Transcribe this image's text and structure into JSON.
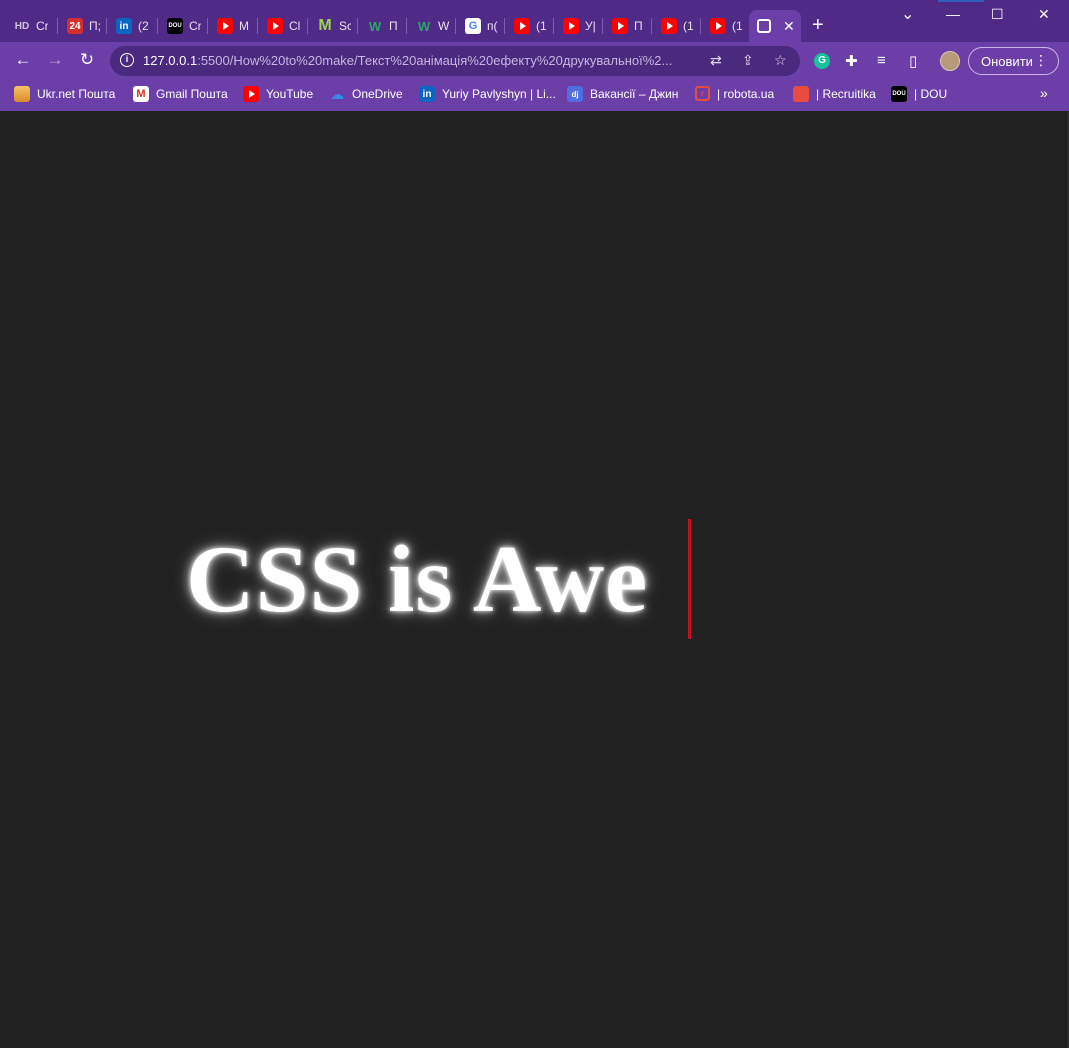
{
  "browser": {
    "tabs": [
      {
        "favicon": "hd-icon",
        "title": "Cr"
      },
      {
        "favicon": "news24-icon",
        "title": "П;"
      },
      {
        "favicon": "linkedin-icon",
        "title": "(2"
      },
      {
        "favicon": "dou-icon",
        "title": "Cr"
      },
      {
        "favicon": "youtube-icon",
        "title": "M"
      },
      {
        "favicon": "youtube-icon",
        "title": "Cl"
      },
      {
        "favicon": "m-icon",
        "title": "Sc"
      },
      {
        "favicon": "w-icon",
        "title": "П"
      },
      {
        "favicon": "w-icon",
        "title": "W"
      },
      {
        "favicon": "google-icon",
        "title": "п("
      },
      {
        "favicon": "youtube-icon",
        "title": "(1"
      },
      {
        "favicon": "youtube-icon",
        "title": "У|"
      },
      {
        "favicon": "youtube-icon",
        "title": "П"
      },
      {
        "favicon": "youtube-icon",
        "title": "(1"
      },
      {
        "favicon": "youtube-icon",
        "title": "(1"
      }
    ],
    "active_tab": {
      "favicon": "globe-icon",
      "close": "✕"
    },
    "new_tab": "+",
    "window_controls": {
      "dropdown": "⌄",
      "minimize": "—",
      "maximize": "☐",
      "close": "✕"
    },
    "url": {
      "host": "127.0.0.1",
      "rest": ":5500/How%20to%20make/Текст%20анімація%20ефекту%20друкувальної%2..."
    },
    "update_button": "Оновити",
    "bookmarks": [
      {
        "favicon": "ukrnet-icon",
        "label": "Ukr.net Пошта"
      },
      {
        "favicon": "gmail-icon",
        "label": "Gmail Пошта"
      },
      {
        "favicon": "youtube-icon",
        "label": "YouTube"
      },
      {
        "favicon": "onedrive-icon",
        "label": "OneDrive"
      },
      {
        "favicon": "linkedin-icon",
        "label": "Yuriy Pavlyshyn | Li..."
      },
      {
        "favicon": "djinni-icon",
        "label": "Вакансії – Джин"
      },
      {
        "favicon": "robota-icon",
        "label": "| robota.ua"
      },
      {
        "favicon": "recruitika-icon",
        "label": "| Recruitika"
      },
      {
        "favicon": "dou-icon",
        "label": "| DOU"
      }
    ],
    "bookmarks_overflow": "»"
  },
  "page": {
    "typed_text": "CSS is Awe",
    "colors": {
      "background": "#212121",
      "text": "#ffffff",
      "caret": "#c0121e",
      "chrome": "#6c3fa8",
      "tabstrip": "#4f2a86"
    }
  }
}
